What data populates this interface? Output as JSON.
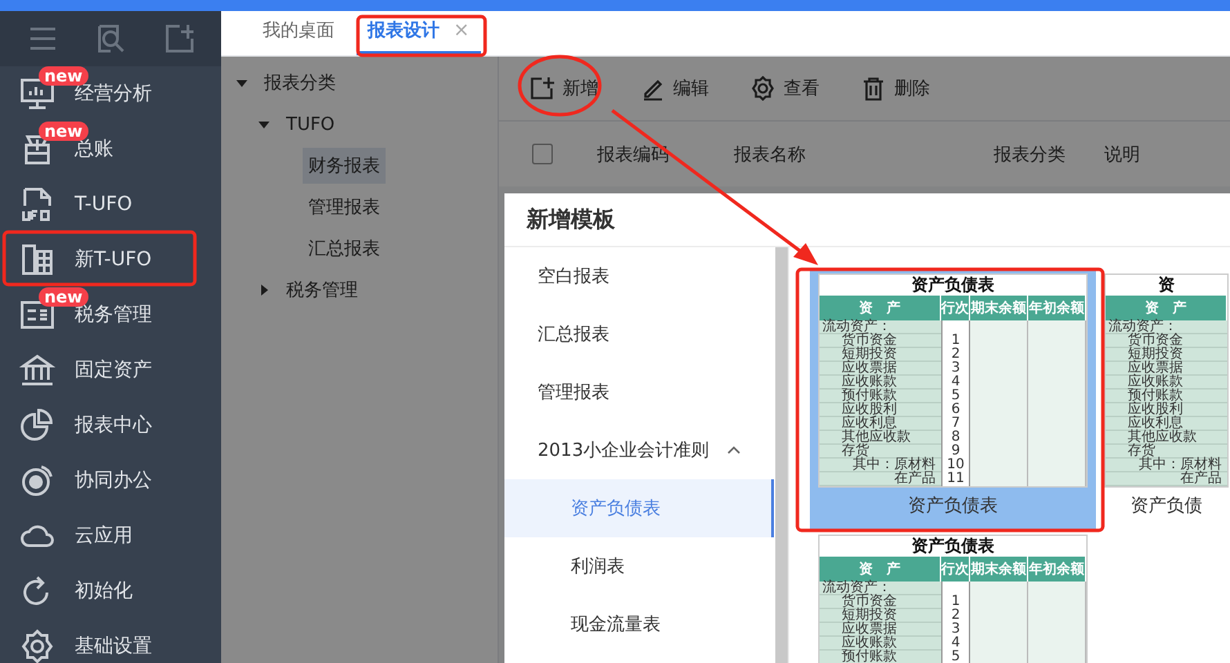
{
  "sidebar": {
    "items": [
      {
        "label": "经营分析",
        "badge": "new"
      },
      {
        "label": "总账",
        "badge": "new"
      },
      {
        "label": "T-UFO"
      },
      {
        "label": "新T-UFO"
      },
      {
        "label": "税务管理",
        "badge": "new"
      },
      {
        "label": "固定资产"
      },
      {
        "label": "报表中心"
      },
      {
        "label": "协同办公"
      },
      {
        "label": "云应用"
      },
      {
        "label": "初始化"
      },
      {
        "label": "基础设置"
      }
    ]
  },
  "tabs": [
    {
      "label": "我的桌面",
      "selected": false
    },
    {
      "label": "报表设计",
      "selected": true,
      "close": "×"
    }
  ],
  "tree": [
    {
      "label": "报表分类",
      "expanded": true,
      "selected": false,
      "children": [
        {
          "label": "TUFO",
          "expanded": true,
          "selected": false,
          "children": [
            {
              "label": "财务报表",
              "selected": true
            },
            {
              "label": "管理报表",
              "selected": false
            },
            {
              "label": "汇总报表",
              "selected": false
            }
          ]
        },
        {
          "label": "税务管理",
          "expanded": false,
          "selected": false
        }
      ]
    }
  ],
  "toolbar": [
    {
      "label": "新增"
    },
    {
      "label": "编辑"
    },
    {
      "label": "查看"
    },
    {
      "label": "删除"
    }
  ],
  "table": {
    "select_all_checked": false,
    "columns": [
      "报表编码",
      "报表名称",
      "报表分类",
      "说明"
    ]
  },
  "modal": {
    "title": "新增模板",
    "categories": [
      {
        "label": "空白报表",
        "selected": false
      },
      {
        "label": "汇总报表",
        "selected": false
      },
      {
        "label": "管理报表",
        "selected": false
      },
      {
        "label": "2013小企业会计准则",
        "selected": false,
        "expanded": true,
        "children": [
          {
            "label": "资产负债表",
            "selected": true
          },
          {
            "label": "利润表",
            "selected": false
          },
          {
            "label": "现金流量表",
            "selected": false
          }
        ]
      }
    ],
    "templates": [
      {
        "selected": true,
        "caption": "资产负债表",
        "preview": {
          "title": "资产负债表",
          "headers": [
            "资　产",
            "行次",
            "期末余额",
            "年初余额"
          ],
          "rows": [
            {
              "kind": "group",
              "label": "流动资产："
            },
            {
              "kind": "item",
              "label": "货币资金",
              "line": "1"
            },
            {
              "kind": "item",
              "label": "短期投资",
              "line": "2"
            },
            {
              "kind": "item",
              "label": "应收票据",
              "line": "3"
            },
            {
              "kind": "item",
              "label": "应收账款",
              "line": "4"
            },
            {
              "kind": "item",
              "label": "预付账款",
              "line": "5"
            },
            {
              "kind": "item",
              "label": "应收股利",
              "line": "6"
            },
            {
              "kind": "item",
              "label": "应收利息",
              "line": "7"
            },
            {
              "kind": "item",
              "label": "其他应收款",
              "line": "8"
            },
            {
              "kind": "item",
              "label": "存货",
              "line": "9"
            },
            {
              "kind": "subitem",
              "label": "其中：原材料",
              "line": "10"
            },
            {
              "kind": "continued",
              "label": "在产品",
              "line": "11"
            }
          ]
        }
      },
      {
        "selected": false,
        "caption": "资产负债",
        "preview": {
          "title": "资",
          "headers": [
            "资　产"
          ],
          "rows": [
            {
              "kind": "group",
              "label": "流动资产："
            },
            {
              "kind": "item",
              "label": "货币资金"
            },
            {
              "kind": "item",
              "label": "短期投资"
            },
            {
              "kind": "item",
              "label": "应收票据"
            },
            {
              "kind": "item",
              "label": "应收账款"
            },
            {
              "kind": "item",
              "label": "预付账款"
            },
            {
              "kind": "item",
              "label": "应收股利"
            },
            {
              "kind": "item",
              "label": "应收利息"
            },
            {
              "kind": "item",
              "label": "其他应收款"
            },
            {
              "kind": "item",
              "label": "存货"
            },
            {
              "kind": "subitem",
              "label": "其中：原材料"
            },
            {
              "kind": "continued",
              "label": "在产品"
            }
          ]
        }
      },
      {
        "selected": false,
        "preview": {
          "title": "资产负债表",
          "headers": [
            "资　产",
            "行次",
            "期末余额",
            "年初余额"
          ],
          "rows": [
            {
              "kind": "group",
              "label": "流动资产："
            },
            {
              "kind": "item",
              "label": "货币资金",
              "line": "1"
            },
            {
              "kind": "item",
              "label": "短期投资",
              "line": "2"
            },
            {
              "kind": "item",
              "label": "应收票据",
              "line": "3"
            },
            {
              "kind": "item",
              "label": "应收账款",
              "line": "4"
            },
            {
              "kind": "item",
              "label": "预付账款",
              "line": "5"
            }
          ]
        }
      }
    ]
  }
}
